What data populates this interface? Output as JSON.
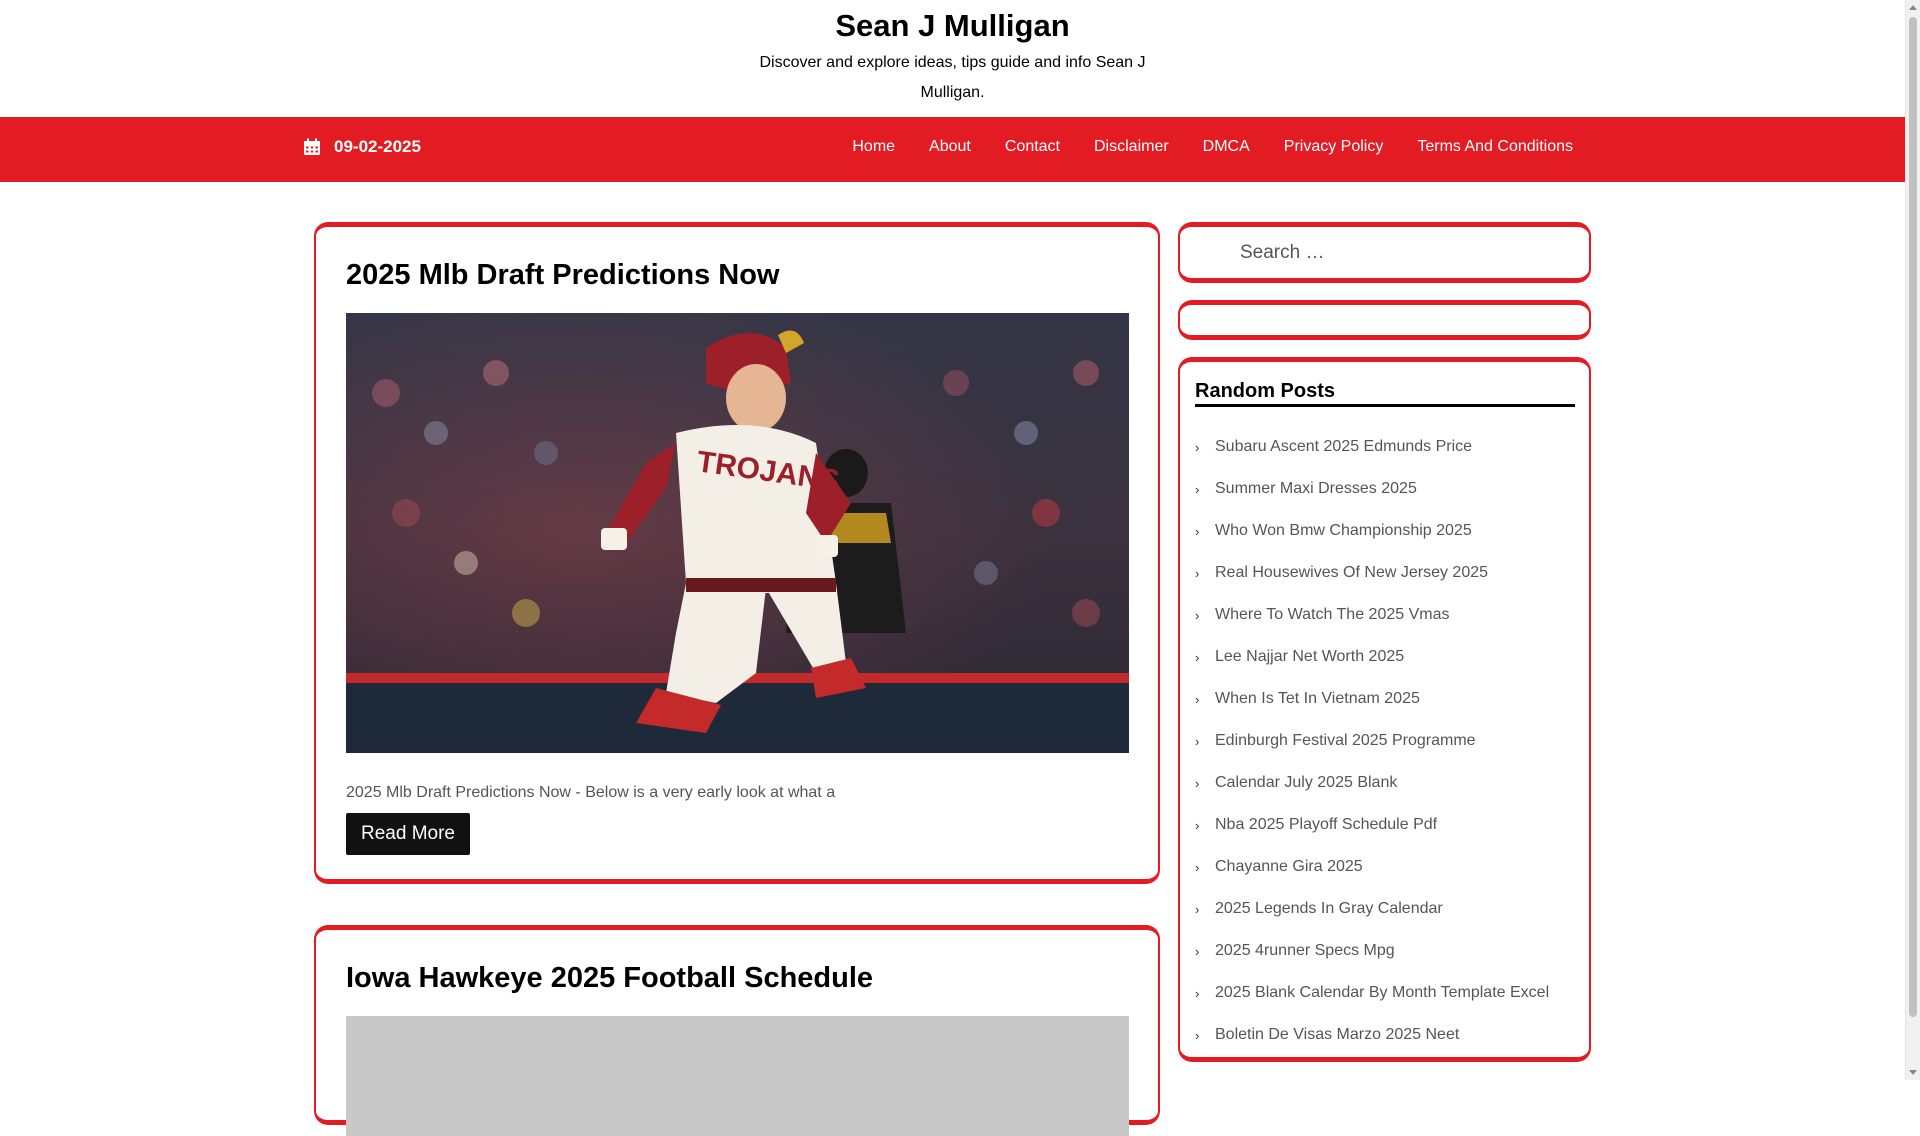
{
  "site": {
    "title": "Sean J Mulligan",
    "tagline": "Discover and explore ideas, tips guide and info Sean J Mulligan."
  },
  "navbar": {
    "date": "09-02-2025",
    "date_icon": "calendar-icon",
    "items": [
      {
        "label": "Home"
      },
      {
        "label": "About"
      },
      {
        "label": "Contact"
      },
      {
        "label": "Disclaimer"
      },
      {
        "label": "DMCA"
      },
      {
        "label": "Privacy Policy"
      },
      {
        "label": "Terms And Conditions"
      }
    ]
  },
  "posts": [
    {
      "title": "2025 Mlb Draft Predictions Now",
      "excerpt": "2025 Mlb Draft Predictions Now - Below is a very early look at what a",
      "read_more": "Read More",
      "image_jersey_text": "TROJANS"
    },
    {
      "title": "Iowa Hawkeye 2025 Football Schedule"
    }
  ],
  "sidebar": {
    "search_placeholder": "Search …",
    "random_posts_title": "Random Posts",
    "random_posts": [
      "Subaru Ascent 2025 Edmunds Price",
      "Summer Maxi Dresses 2025",
      "Who Won Bmw Championship 2025",
      "Real Housewives Of New Jersey 2025",
      "Where To Watch The 2025 Vmas",
      "Lee Najjar Net Worth 2025",
      "When Is Tet In Vietnam 2025",
      "Edinburgh Festival 2025 Programme",
      "Calendar July 2025 Blank",
      "Nba 2025 Playoff Schedule Pdf",
      "Chayanne Gira 2025",
      "2025 Legends In Gray Calendar",
      "2025 4runner Specs Mpg",
      "2025 Blank Calendar By Month Template Excel",
      "Boletin De Visas Marzo 2025 Neet"
    ]
  },
  "colors": {
    "accent": "#e31b23",
    "button": "#111111"
  }
}
